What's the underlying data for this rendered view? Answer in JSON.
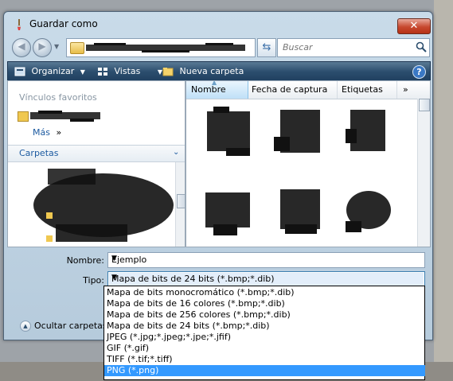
{
  "window": {
    "title": "Guardar como",
    "close_label": "✕"
  },
  "nav": {
    "address_text": "",
    "search_placeholder": "Buscar"
  },
  "toolbar": {
    "organize": "Organizar",
    "views": "Vistas",
    "new_folder": "Nueva carpeta",
    "help": "?"
  },
  "left_pane": {
    "favorites_header": "Vínculos favoritos",
    "more_label": "Más",
    "more_arrows": "»",
    "folders_header": "Carpetas"
  },
  "columns": {
    "name": "Nombre",
    "date": "Fecha de captura",
    "tags": "Etiquetas",
    "more": "»"
  },
  "form": {
    "name_label": "Nombre:",
    "name_value": "Ejemplo",
    "type_label": "Tipo:",
    "type_value": "Mapa de bits de 24 bits (*.bmp;*.dib)",
    "hide_folders": "Ocultar carpetas"
  },
  "type_options": [
    "Mapa de bits monocromático (*.bmp;*.dib)",
    "Mapa de bits de 16 colores (*.bmp;*.dib)",
    "Mapa de bits de 256 colores (*.bmp;*.dib)",
    "Mapa de bits de 24 bits (*.bmp;*.dib)",
    "JPEG (*.jpg;*.jpeg;*.jpe;*.jfif)",
    "GIF (*.gif)",
    "TIFF (*.tif;*.tiff)",
    "PNG (*.png)"
  ],
  "selected_option_index": 7,
  "colors": {
    "toolbar": "#2c4e6e",
    "selection": "#3399ff",
    "link": "#1c5aa0",
    "close": "#c7482f"
  }
}
